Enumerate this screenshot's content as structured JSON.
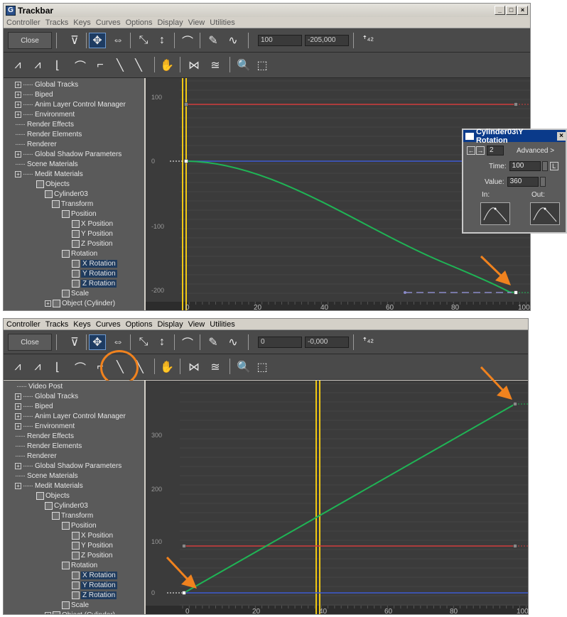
{
  "window1": {
    "title": "Trackbar",
    "menu": [
      "Controller",
      "Tracks",
      "Keys",
      "Curves",
      "Options",
      "Display",
      "View",
      "Utilities"
    ],
    "close_label": "Close",
    "frame_field": "100",
    "value_field": "-205,000",
    "tree": [
      {
        "label": "Global Tracks",
        "expander": "+"
      },
      {
        "label": "Biped",
        "expander": "+"
      },
      {
        "label": "Anim Layer Control Manager",
        "expander": "+"
      },
      {
        "label": "Environment",
        "expander": "+"
      },
      {
        "label": "Render Effects",
        "expander": ""
      },
      {
        "label": "Render Elements",
        "expander": ""
      },
      {
        "label": "Renderer",
        "expander": ""
      },
      {
        "label": "Global Shadow Parameters",
        "expander": "+"
      },
      {
        "label": "Scene Materials",
        "expander": ""
      },
      {
        "label": "Medit Materials",
        "expander": "+"
      },
      {
        "label": "Objects",
        "expander": ""
      },
      {
        "label": "Cylinder03",
        "expander": ""
      },
      {
        "label": "Transform",
        "expander": ""
      },
      {
        "label": "Position",
        "expander": ""
      },
      {
        "label": "X Position",
        "expander": ""
      },
      {
        "label": "Y Position",
        "expander": ""
      },
      {
        "label": "Z Position",
        "expander": ""
      },
      {
        "label": "Rotation",
        "expander": ""
      },
      {
        "label": "X Rotation",
        "expander": ""
      },
      {
        "label": "Y Rotation",
        "expander": ""
      },
      {
        "label": "Z Rotation",
        "expander": ""
      },
      {
        "label": "Scale",
        "expander": ""
      },
      {
        "label": "Object (Cylinder)",
        "expander": "+"
      }
    ],
    "y_labels": [
      "100",
      "0",
      "-100",
      "-200"
    ],
    "x_labels": [
      "0",
      "20",
      "40",
      "60",
      "80",
      "100"
    ],
    "dialog": {
      "title": "Cylinder03\\Y Rotation",
      "key_number": "2",
      "advanced_label": "Advanced >",
      "time_label": "Time:",
      "time_value": "100",
      "lock_label": "L",
      "value_label": "Value:",
      "value_value": "360",
      "in_label": "In:",
      "out_label": "Out:"
    }
  },
  "window2": {
    "menu": [
      "Controller",
      "Tracks",
      "Keys",
      "Curves",
      "Options",
      "Display",
      "View",
      "Utilities"
    ],
    "close_label": "Close",
    "frame_field": "0",
    "value_field": "-0,000",
    "tree": [
      {
        "label": "Video Post",
        "expander": ""
      },
      {
        "label": "Global Tracks",
        "expander": "+"
      },
      {
        "label": "Biped",
        "expander": "+"
      },
      {
        "label": "Anim Layer Control Manager",
        "expander": "+"
      },
      {
        "label": "Environment",
        "expander": "+"
      },
      {
        "label": "Render Effects",
        "expander": ""
      },
      {
        "label": "Render Elements",
        "expander": ""
      },
      {
        "label": "Renderer",
        "expander": ""
      },
      {
        "label": "Global Shadow Parameters",
        "expander": "+"
      },
      {
        "label": "Scene Materials",
        "expander": ""
      },
      {
        "label": "Medit Materials",
        "expander": "+"
      },
      {
        "label": "Objects",
        "expander": ""
      },
      {
        "label": "Cylinder03",
        "expander": ""
      },
      {
        "label": "Transform",
        "expander": ""
      },
      {
        "label": "Position",
        "expander": ""
      },
      {
        "label": "X Position",
        "expander": ""
      },
      {
        "label": "Y Position",
        "expander": ""
      },
      {
        "label": "Z Position",
        "expander": ""
      },
      {
        "label": "Rotation",
        "expander": ""
      },
      {
        "label": "X Rotation",
        "expander": ""
      },
      {
        "label": "Y Rotation",
        "expander": ""
      },
      {
        "label": "Z Rotation",
        "expander": ""
      },
      {
        "label": "Scale",
        "expander": ""
      },
      {
        "label": "Object (Cylinder)",
        "expander": "+"
      }
    ],
    "y_labels": [
      "300",
      "200",
      "100",
      "0"
    ],
    "x_labels": [
      "0",
      "20",
      "40",
      "60",
      "80",
      "100"
    ]
  },
  "colors": {
    "annotation": "#f0821e",
    "curve_green": "#1fb455",
    "curve_red": "#d23c3c",
    "curve_blue": "#3c5ad2",
    "time_slider": "#f0c814",
    "selection": "#1f3b5e"
  }
}
